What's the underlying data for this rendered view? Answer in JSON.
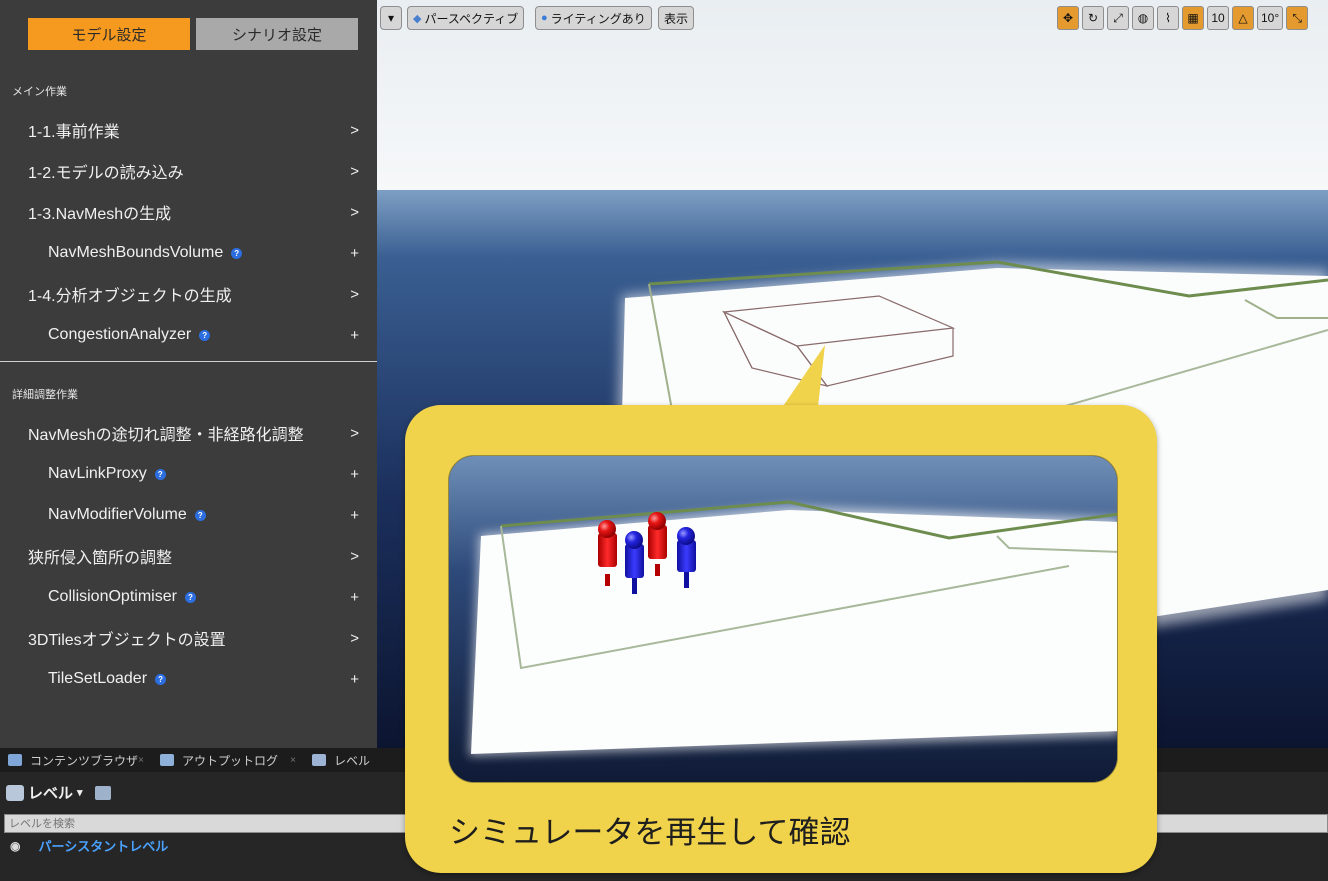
{
  "mode_tabs": {
    "model": "モデル設定",
    "scenario": "シナリオ設定",
    "active": "model"
  },
  "main_section": {
    "title": "メイン作業",
    "items": [
      {
        "label": "1-1.事前作業",
        "action": ">"
      },
      {
        "label": "1-2.モデルの読み込み",
        "action": ">"
      },
      {
        "label": "1-3.NavMeshの生成",
        "action": ">"
      },
      {
        "label": "NavMeshBoundsVolume",
        "action": "+",
        "info": "?"
      },
      {
        "label": "1-4.分析オブジェクトの生成",
        "action": ">"
      },
      {
        "label": "CongestionAnalyzer",
        "action": "+",
        "info": "?"
      }
    ]
  },
  "detail_section": {
    "title": "詳細調整作業",
    "items": [
      {
        "label": "NavMeshの途切れ調整・非経路化調整",
        "action": ">"
      },
      {
        "label": "NavLinkProxy",
        "action": "+",
        "info": "?"
      },
      {
        "label": "NavModifierVolume",
        "action": "+",
        "info": "?"
      },
      {
        "label": "狭所侵入箇所の調整",
        "action": ">"
      },
      {
        "label": "CollisionOptimiser",
        "action": "+",
        "info": "?"
      },
      {
        "label": "3DTilesオブジェクトの設置",
        "action": ">"
      },
      {
        "label": "TileSetLoader",
        "action": "+",
        "info": "?"
      }
    ]
  },
  "viewport_toolbar": {
    "dropdown": "▾",
    "perspective": "パースペクティブ",
    "lighting": "ライティングあり",
    "show": "表示",
    "grid_snap": "10",
    "rotation_snap": "10°"
  },
  "bottom_tabs": [
    {
      "label": "コンテンツブラウザ",
      "close": "×"
    },
    {
      "label": "アウトプットログ",
      "close": "×"
    },
    {
      "label": "レベル",
      "close": ""
    }
  ],
  "levels": {
    "header": "レベル",
    "dropdown": "▾",
    "search_placeholder": "レベルを検索",
    "items": [
      "パーシスタントレベル"
    ]
  },
  "callout": {
    "caption": "シミュレータを再生して確認"
  },
  "colors": {
    "accent_orange": "#f59a1e",
    "callout_yellow": "#f0d34a",
    "agent_red": "#e01818",
    "agent_blue": "#2222dd"
  }
}
